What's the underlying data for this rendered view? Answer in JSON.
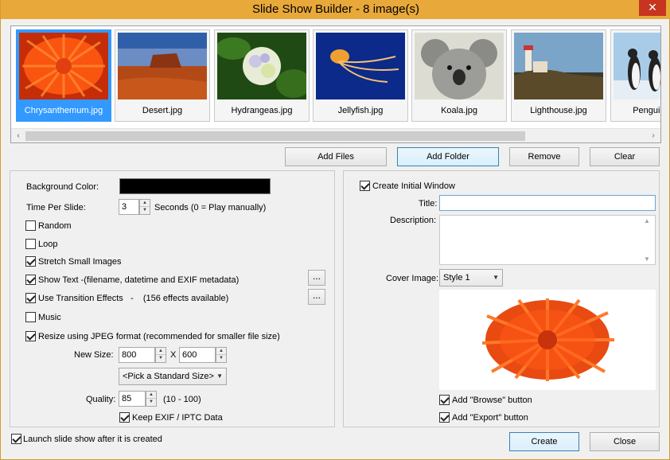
{
  "window": {
    "title": "Slide Show Builder - 8 image(s)",
    "close_glyph": "✕"
  },
  "gallery": {
    "items": [
      {
        "name": "Chrysanthemum.jpg",
        "selected": true
      },
      {
        "name": "Desert.jpg",
        "selected": false
      },
      {
        "name": "Hydrangeas.jpg",
        "selected": false
      },
      {
        "name": "Jellyfish.jpg",
        "selected": false
      },
      {
        "name": "Koala.jpg",
        "selected": false
      },
      {
        "name": "Lighthouse.jpg",
        "selected": false
      },
      {
        "name": "Penguins.jpg",
        "selected": false
      }
    ],
    "scroll_left": "‹",
    "scroll_right": "›"
  },
  "file_buttons": {
    "add_files": "Add Files",
    "add_folder": "Add Folder",
    "remove": "Remove",
    "clear": "Clear"
  },
  "left": {
    "background_color_label": "Background Color:",
    "background_color": "#000000",
    "time_per_slide_label": "Time Per Slide:",
    "time_per_slide_value": "3",
    "time_per_slide_note": "Seconds (0 = Play  manually)",
    "random": {
      "label": "Random",
      "checked": false
    },
    "loop": {
      "label": "Loop",
      "checked": false
    },
    "stretch": {
      "label": "Stretch Small Images",
      "checked": true
    },
    "show_text": {
      "label": "Show Text -(filename, datetime and EXIF metadata)",
      "checked": true
    },
    "transitions": {
      "label": "Use Transition Effects   -    (156 effects available)",
      "checked": true
    },
    "music": {
      "label": "Music",
      "checked": false
    },
    "resize": {
      "label": "Resize using JPEG format (recommended for smaller file size)",
      "checked": true
    },
    "new_size_label": "New Size:",
    "width": "800",
    "x_label": "X",
    "height": "600",
    "standard_size": "<Pick a Standard Size>",
    "quality_label": "Quality:",
    "quality": "85",
    "quality_range": "(10 - 100)",
    "keep_exif": {
      "label": "Keep EXIF / IPTC Data",
      "checked": true
    },
    "ellipsis": "..."
  },
  "right": {
    "create_initial": {
      "label": "Create Initial Window",
      "checked": true
    },
    "title_label": "Title:",
    "title_value": "",
    "description_label": "Description:",
    "cover_label": "Cover Image:",
    "cover_style": "Style 1",
    "browse": {
      "label": "Add \"Browse\" button",
      "checked": true
    },
    "export": {
      "label": "Add \"Export\" button",
      "checked": true
    }
  },
  "footer": {
    "launch": {
      "label": "Launch slide show after it is created",
      "checked": true
    },
    "create": "Create",
    "close": "Close"
  },
  "colors": {
    "titlebar": "#e8a93a",
    "selection": "#3399ff",
    "close": "#c7341f"
  }
}
